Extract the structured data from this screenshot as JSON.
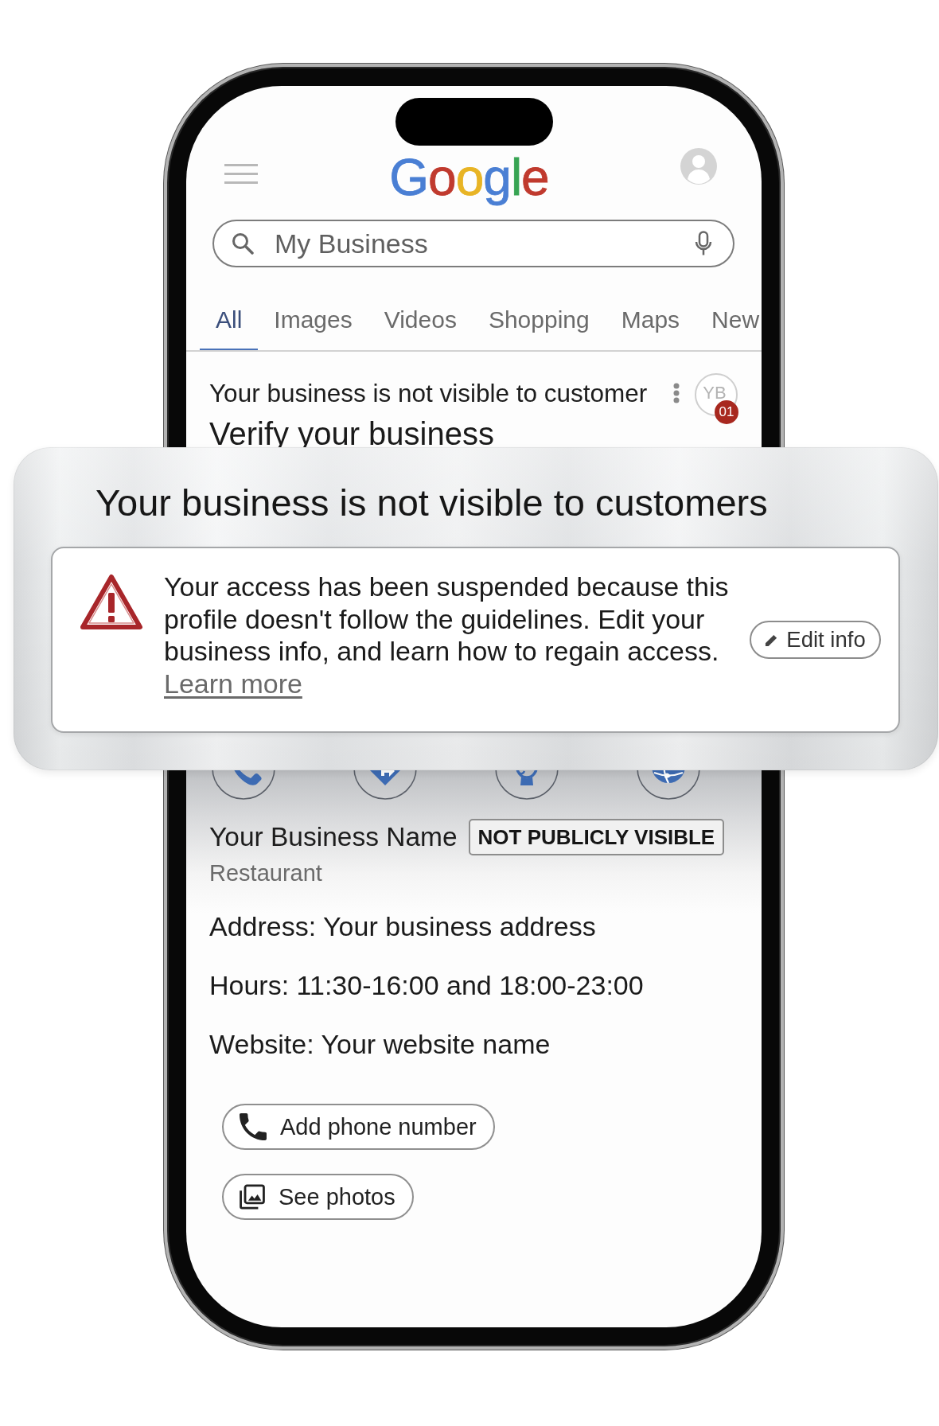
{
  "header": {
    "logo": "Google"
  },
  "search": {
    "value": "My Business"
  },
  "tabs": [
    {
      "label": "All",
      "selected": true
    },
    {
      "label": "Images",
      "selected": false
    },
    {
      "label": "Videos",
      "selected": false
    },
    {
      "label": "Shopping",
      "selected": false
    },
    {
      "label": "Maps",
      "selected": false
    },
    {
      "label": "New",
      "selected": false
    }
  ],
  "notification": {
    "title": "Your business is not visible to customer",
    "subtitle": "Verify your business",
    "avatar": "YB",
    "badge": "01"
  },
  "alert": {
    "title": "Your business is not visible to customers",
    "message": "Your access has been suspended because this profile doesn't follow the guidelines. Edit your business info, and learn how to regain access.",
    "link": "Learn more",
    "button": "Edit info"
  },
  "business": {
    "name": "Your Business Name",
    "status": "NOT PUBLICLY VISIBLE",
    "category": "Restaurant",
    "details": [
      "Address: Your business address",
      "Hours: 11:30-16:00 and 18:00-23:00",
      "Website: Your website name"
    ]
  },
  "buttons": [
    {
      "label": "Add phone number"
    },
    {
      "label": "See photos"
    }
  ]
}
